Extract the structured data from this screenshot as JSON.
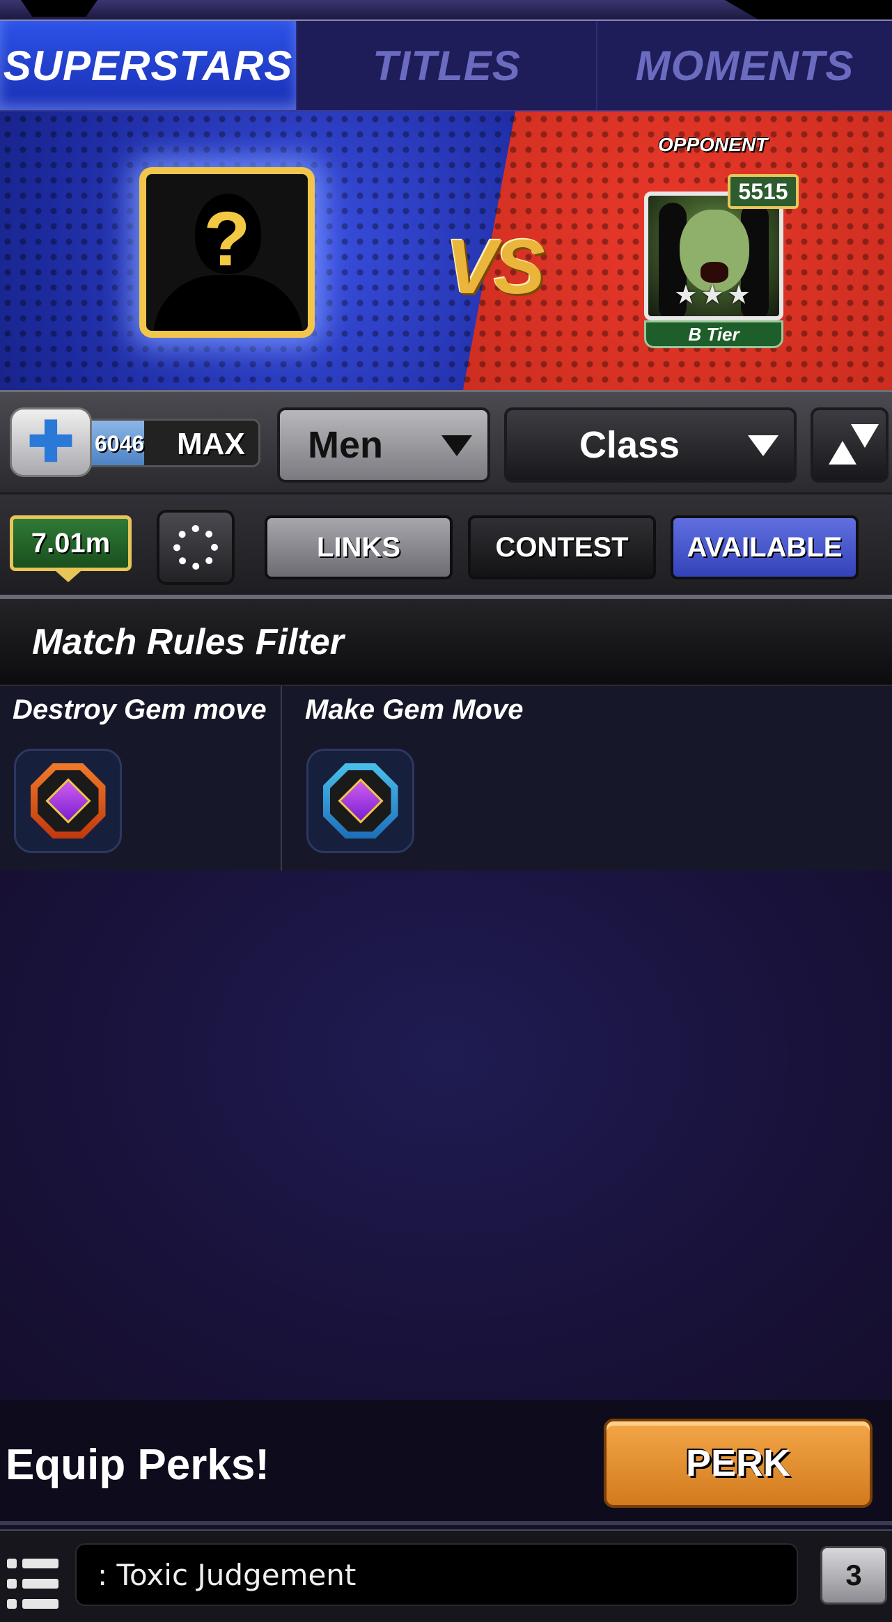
{
  "tabs": {
    "superstars": "SUPERSTARS",
    "titles": "TITLES",
    "moments": "MOMENTS"
  },
  "versus": {
    "player_placeholder": "?",
    "vs_label": "VS",
    "opponent_label": "OPPONENT",
    "opponent_power": "5515",
    "opponent_stars": "★★★",
    "opponent_tier": "B Tier"
  },
  "filters": {
    "boost_value": "6046",
    "boost_level": "MAX",
    "gender_selected": "Men",
    "class_selected": "Class"
  },
  "actions": {
    "cash": "7.01m",
    "links_label": "LINKS",
    "contest_label": "CONTEST",
    "available_label": "AVAILABLE"
  },
  "match_rules": {
    "title": "Match Rules Filter",
    "rules": [
      {
        "label": "Destroy Gem move",
        "icon": "destroy-gem-icon"
      },
      {
        "label": "Make Gem Move",
        "icon": "make-gem-icon"
      }
    ]
  },
  "perk": {
    "label": "Equip Perks!",
    "button_label": "PERK"
  },
  "chat": {
    "message": ": Toxic Judgement",
    "count": "3"
  }
}
